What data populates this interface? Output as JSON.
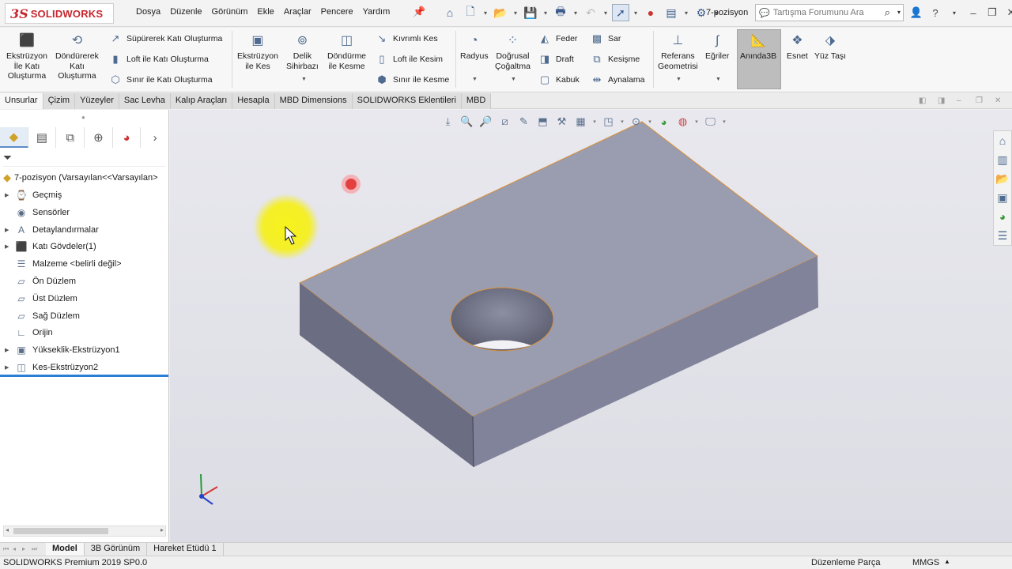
{
  "app": {
    "logo_ds": "3S",
    "logo_brand": "SOLIDWORKS",
    "document_name": "7-pozisyon"
  },
  "menu": [
    "Dosya",
    "Düzenle",
    "Görünüm",
    "Ekle",
    "Araçlar",
    "Pencere",
    "Yardım"
  ],
  "search": {
    "placeholder": "Tartışma Forumunu Ara"
  },
  "commands": {
    "extrude_boss": "Ekstrüzyon\nİle Katı\nOluşturma",
    "revolve_boss": "Döndürerek\nKatı\nOluşturma",
    "swept_boss": "Süpürerek Katı Oluşturma",
    "lofted_boss": "Loft ile Katı Oluşturma",
    "boundary_boss": "Sınır ile Katı Oluşturma",
    "extrude_cut": "Ekstrüzyon\nile Kes",
    "hole_wizard": "Delik\nSihirbazı",
    "revolve_cut": "Döndürme\nile Kesme",
    "swept_cut": "Kıvrımlı Kes",
    "lofted_cut": "Loft ile Kesim",
    "boundary_cut": "Sınır ile Kesme",
    "fillet": "Radyus",
    "linear_pattern": "Doğrusal\nÇoğaltma",
    "rib": "Feder",
    "draft": "Draft",
    "shell": "Kabuk",
    "wrap": "Sar",
    "intersect": "Kesişme",
    "mirror": "Aynalama",
    "reference_geometry": "Referans\nGeometrisi",
    "curves": "Eğriler",
    "instant3d": "Anında3B",
    "flex": "Esnet",
    "move_face": "Yüz Taşı"
  },
  "tabs": [
    "Unsurlar",
    "Çizim",
    "Yüzeyler",
    "Sac Levha",
    "Kalıp Araçları",
    "Hesapla",
    "MBD Dimensions",
    "SOLIDWORKS Eklentileri",
    "MBD"
  ],
  "feature_tree": {
    "root": "7-pozisyon  (Varsayılan<<Varsayılan>",
    "items": [
      {
        "label": "Geçmiş",
        "expandable": true,
        "icon": "history-icon"
      },
      {
        "label": "Sensörler",
        "expandable": false,
        "icon": "sensor-icon"
      },
      {
        "label": "Detaylandırmalar",
        "expandable": true,
        "icon": "annotation-icon"
      },
      {
        "label": "Katı Gövdeler(1)",
        "expandable": true,
        "icon": "solid-body-icon"
      },
      {
        "label": "Malzeme <belirli değil>",
        "expandable": false,
        "icon": "material-icon"
      },
      {
        "label": "Ön Düzlem",
        "expandable": false,
        "icon": "plane-icon"
      },
      {
        "label": "Üst Düzlem",
        "expandable": false,
        "icon": "plane-icon"
      },
      {
        "label": "Sağ Düzlem",
        "expandable": false,
        "icon": "plane-icon"
      },
      {
        "label": "Orijin",
        "expandable": false,
        "icon": "origin-icon"
      },
      {
        "label": "Yükseklik-Ekstrüzyon1",
        "expandable": true,
        "icon": "boss-extrude-icon"
      },
      {
        "label": "Kes-Ekstrüzyon2",
        "expandable": true,
        "icon": "cut-extrude-icon"
      }
    ]
  },
  "bottom_tabs": [
    "Model",
    "3B Görünüm",
    "Hareket Etüdü 1"
  ],
  "status": {
    "version": "SOLIDWORKS Premium 2019 SP0.0",
    "mode": "Düzenleme Parça",
    "units": "MMGS"
  },
  "colors": {
    "brand_red": "#c6262e",
    "part_top": "#9a9cb0",
    "part_front": "#6b6d82",
    "part_side": "#81839a",
    "edge_highlight": "#d9913a",
    "rollback_bar": "#2a7fd4",
    "cursor_highlight": "#f4f01e"
  }
}
